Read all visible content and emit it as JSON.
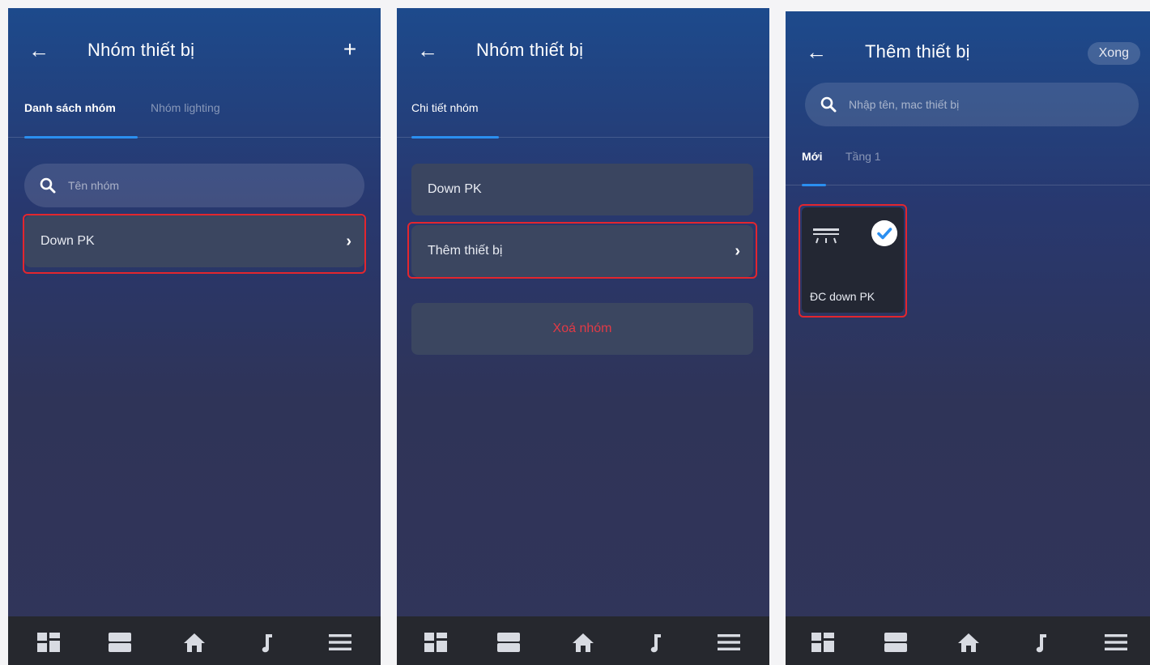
{
  "screen1": {
    "title": "Nhóm thiết bị",
    "tabs": [
      "Danh sách nhóm",
      "Nhóm lighting"
    ],
    "search_placeholder": "Tên nhóm",
    "group_row_label": "Down PK"
  },
  "screen2": {
    "title": "Nhóm thiết bị",
    "tab": "Chi tiết nhóm",
    "group_name": "Down PK",
    "add_device_label": "Thêm thiết bị",
    "delete_label": "Xoá nhóm"
  },
  "screen3": {
    "title": "Thêm thiết bị",
    "done_label": "Xong",
    "search_placeholder": "Nhập tên, mac thiết bị",
    "tabs": [
      "Mới",
      "Tầng 1"
    ],
    "device_label": "ĐC down PK"
  },
  "bottom_nav_icons": [
    "dashboard-icon",
    "rooms-icon",
    "home-icon",
    "music-icon",
    "menu-icon"
  ],
  "colors": {
    "highlight": "#e3262e",
    "tab_underline": "#2b8ff0",
    "danger_text": "#e23a45",
    "check_accent": "#2b8ff0"
  }
}
